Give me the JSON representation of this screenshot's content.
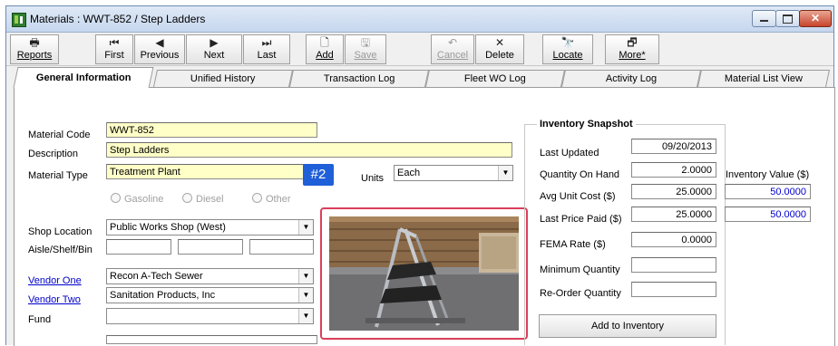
{
  "window": {
    "title": "Materials : WWT-852 / Step Ladders"
  },
  "toolbar": [
    {
      "label": "Reports",
      "icon": "printer-icon",
      "glyph": "🖶",
      "disabled": false
    },
    {
      "label": "First",
      "icon": "first-record-icon",
      "glyph": "⏮",
      "disabled": false
    },
    {
      "label": "Previous",
      "icon": "previous-record-icon",
      "glyph": "◀",
      "disabled": false
    },
    {
      "label": "Next",
      "icon": "next-record-icon",
      "glyph": "▶",
      "disabled": false
    },
    {
      "label": "Last",
      "icon": "last-record-icon",
      "glyph": "⏭",
      "disabled": false
    },
    {
      "label": "Add",
      "icon": "new-document-icon",
      "glyph": "🗋",
      "disabled": false
    },
    {
      "label": "Save",
      "icon": "save-disk-icon",
      "glyph": "🖫",
      "disabled": true
    },
    {
      "label": "Cancel",
      "icon": "undo-icon",
      "glyph": "↶",
      "disabled": true
    },
    {
      "label": "Delete",
      "icon": "delete-x-icon",
      "glyph": "✕",
      "disabled": false
    },
    {
      "label": "Locate",
      "icon": "binoculars-icon",
      "glyph": "🔭",
      "disabled": false
    },
    {
      "label": "More*",
      "icon": "more-options-icon",
      "glyph": "🗗",
      "disabled": false
    }
  ],
  "tabs": [
    "General Information",
    "Unified History",
    "Transaction Log",
    "Fleet WO Log",
    "Activity Log",
    "Material List View"
  ],
  "form": {
    "material_code_label": "Material Code",
    "material_code": "WWT-852",
    "description_label": "Description",
    "description": "Step Ladders",
    "material_type_label": "Material Type",
    "material_type": "Treatment Plant",
    "badge": "#2",
    "units_label": "Units",
    "units": "Each",
    "fuel_options": [
      "Gasoline",
      "Diesel",
      "Other"
    ],
    "shop_location_label": "Shop Location",
    "shop_location": "Public Works Shop (West)",
    "aisle_label": "Aisle/Shelf/Bin",
    "vendor_one_label": "Vendor One",
    "vendor_one": "Recon A-Tech Sewer",
    "vendor_two_label": "Vendor Two",
    "vendor_two": "Sanitation Products, Inc",
    "fund_label": "Fund",
    "fund": ""
  },
  "inventory": {
    "title": "Inventory Snapshot",
    "last_updated_label": "Last Updated",
    "last_updated": "09/20/2013",
    "qty_on_hand_label": "Quantity On Hand",
    "qty_on_hand": "2.0000",
    "avg_unit_cost_label": "Avg Unit Cost ($)",
    "avg_unit_cost": "25.0000",
    "last_price_label": "Last Price Paid ($)",
    "last_price": "25.0000",
    "fema_label": "FEMA Rate ($)",
    "fema": "0.0000",
    "min_qty_label": "Minimum Quantity",
    "reorder_label": "Re-Order Quantity",
    "inv_value_label": "Inventory Value ($)",
    "inv_value_1": "50.0000",
    "inv_value_2": "50.0000",
    "add_button": "Add to Inventory"
  }
}
